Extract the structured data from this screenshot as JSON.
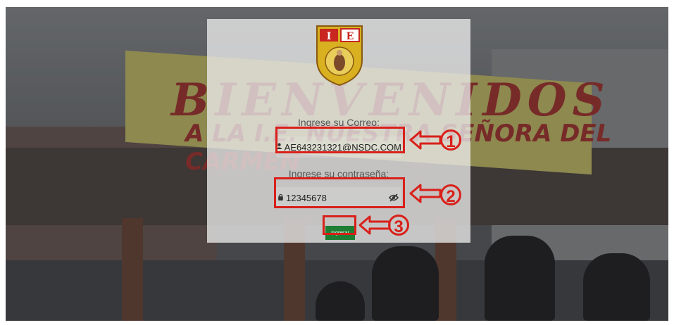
{
  "background": {
    "banner_line1": "BIENVENIDOS",
    "banner_line2": "A LA I.E. NUESTRA SEÑORA DEL CARMEN"
  },
  "login": {
    "crest_letters": [
      "I",
      "E"
    ],
    "email_label": "Ingrese su Correo:",
    "email_value": "AE643231321@NSDC.COM",
    "password_label": "Ingrese su contraseña:",
    "password_value": "12345678",
    "submit_label": "Ingresar"
  },
  "annotations": {
    "step1": "1",
    "step2": "2",
    "step3": "3",
    "color": "#d9201a"
  },
  "icons": {
    "email": "user-icon",
    "password": "lock-icon",
    "toggle": "eye-slash-icon"
  }
}
